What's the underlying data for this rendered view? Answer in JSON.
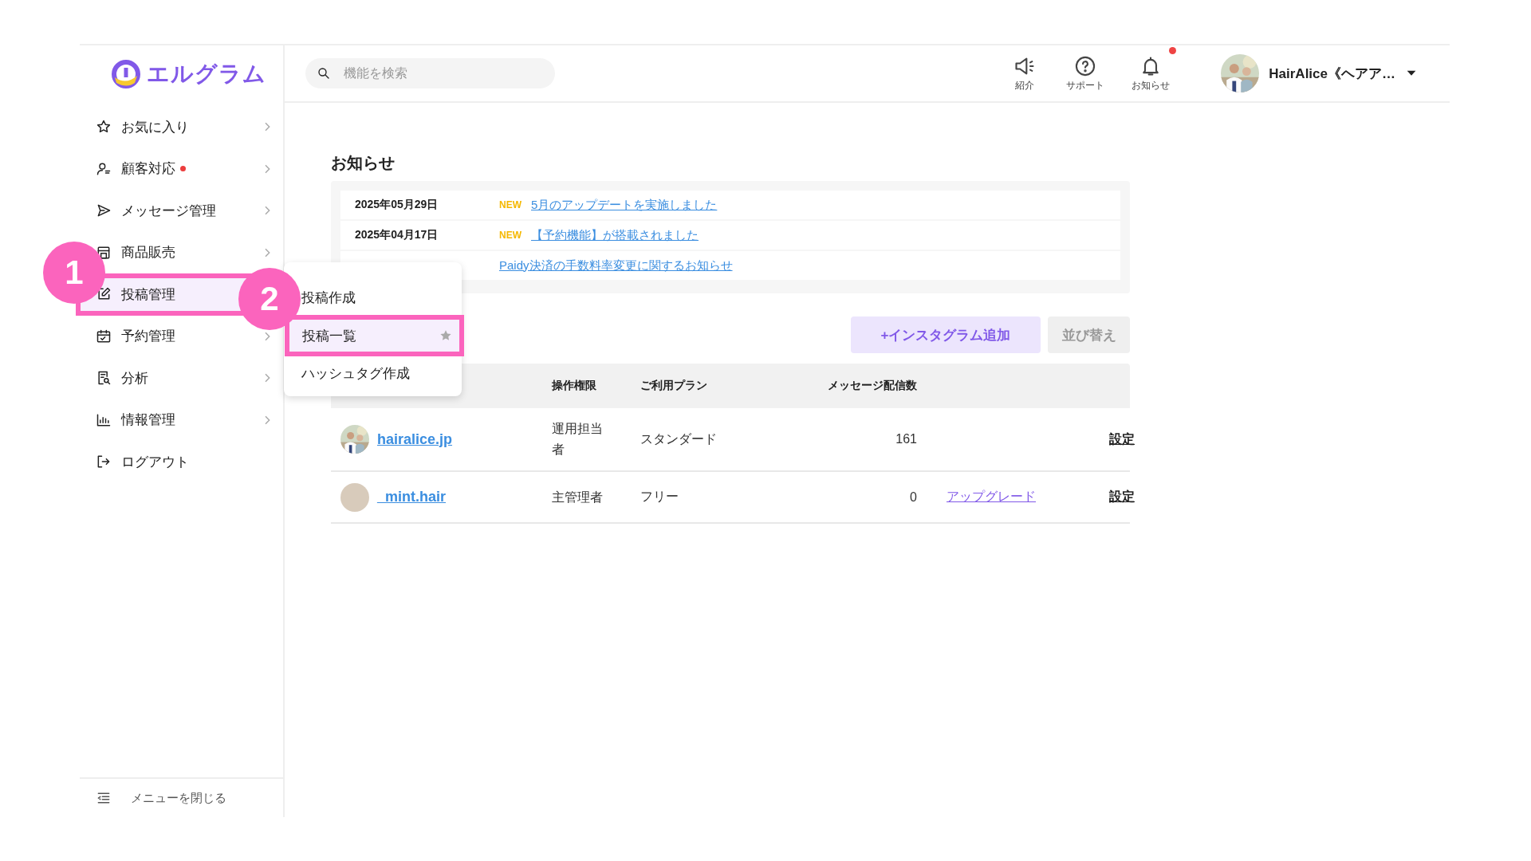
{
  "app": {
    "logo": "エルグラム"
  },
  "sidebar": {
    "items": [
      {
        "label": "お気に入り",
        "kind": "group",
        "alert": false,
        "selected": false
      },
      {
        "label": "顧客対応",
        "kind": "group",
        "alert": true,
        "selected": false
      },
      {
        "label": "メッセージ管理",
        "kind": "group",
        "alert": false,
        "selected": false
      },
      {
        "label": "商品販売",
        "kind": "group",
        "alert": false,
        "selected": false
      },
      {
        "label": "投稿管理",
        "kind": "group",
        "alert": false,
        "selected": true
      },
      {
        "label": "予約管理",
        "kind": "group",
        "alert": false,
        "selected": false
      },
      {
        "label": "分析",
        "kind": "group",
        "alert": false,
        "selected": false
      },
      {
        "label": "情報管理",
        "kind": "group",
        "alert": false,
        "selected": false
      },
      {
        "label": "ログアウト",
        "kind": "link",
        "alert": false,
        "selected": false
      }
    ],
    "collapse": "メニューを閉じる"
  },
  "header": {
    "search": {
      "placeholder": "機能を検索"
    },
    "actions": [
      {
        "label": "紹介",
        "notification": false
      },
      {
        "label": "サポート",
        "notification": false
      },
      {
        "label": "お知らせ",
        "notification": true
      }
    ],
    "user": {
      "name": "HairAlice《ヘアア…"
    }
  },
  "news": {
    "title": "お知らせ",
    "items": [
      {
        "date": "2025年05月29日",
        "tag": "NEW",
        "title": "5月のアップデートを実施しました"
      },
      {
        "date": "2025年04月17日",
        "tag": "NEW",
        "title": "【予約機能】が搭載されました"
      },
      {
        "title": "Paidy決済の手数料率変更に関するお知らせ"
      }
    ]
  },
  "accounts": {
    "buttons": [
      {
        "kind": "primary",
        "label": "+インスタグラム追加"
      },
      {
        "kind": "secondary",
        "label": "並び替え"
      }
    ],
    "columns": [
      "操作権限",
      "ご利用プラン",
      "メッセージ配信数"
    ],
    "rows": [
      {
        "name": "hairalice.jp",
        "role": "運用担当者",
        "plan": "スタンダード",
        "count": "161",
        "settings": "設定"
      },
      {
        "name": "_mint.hair",
        "role": "主管理者",
        "plan": "フリー",
        "count": "0",
        "upgrade": "アップグレード",
        "settings": "設定"
      }
    ]
  },
  "submenu": {
    "items": [
      {
        "label": "投稿作成",
        "selected": false
      },
      {
        "label": "投稿一覧",
        "selected": true
      },
      {
        "label": "ハッシュタグ作成",
        "selected": false
      }
    ]
  },
  "callouts": [
    {
      "label": "1",
      "kind": "sidebar"
    },
    {
      "label": "2",
      "kind": "submenu"
    }
  ]
}
